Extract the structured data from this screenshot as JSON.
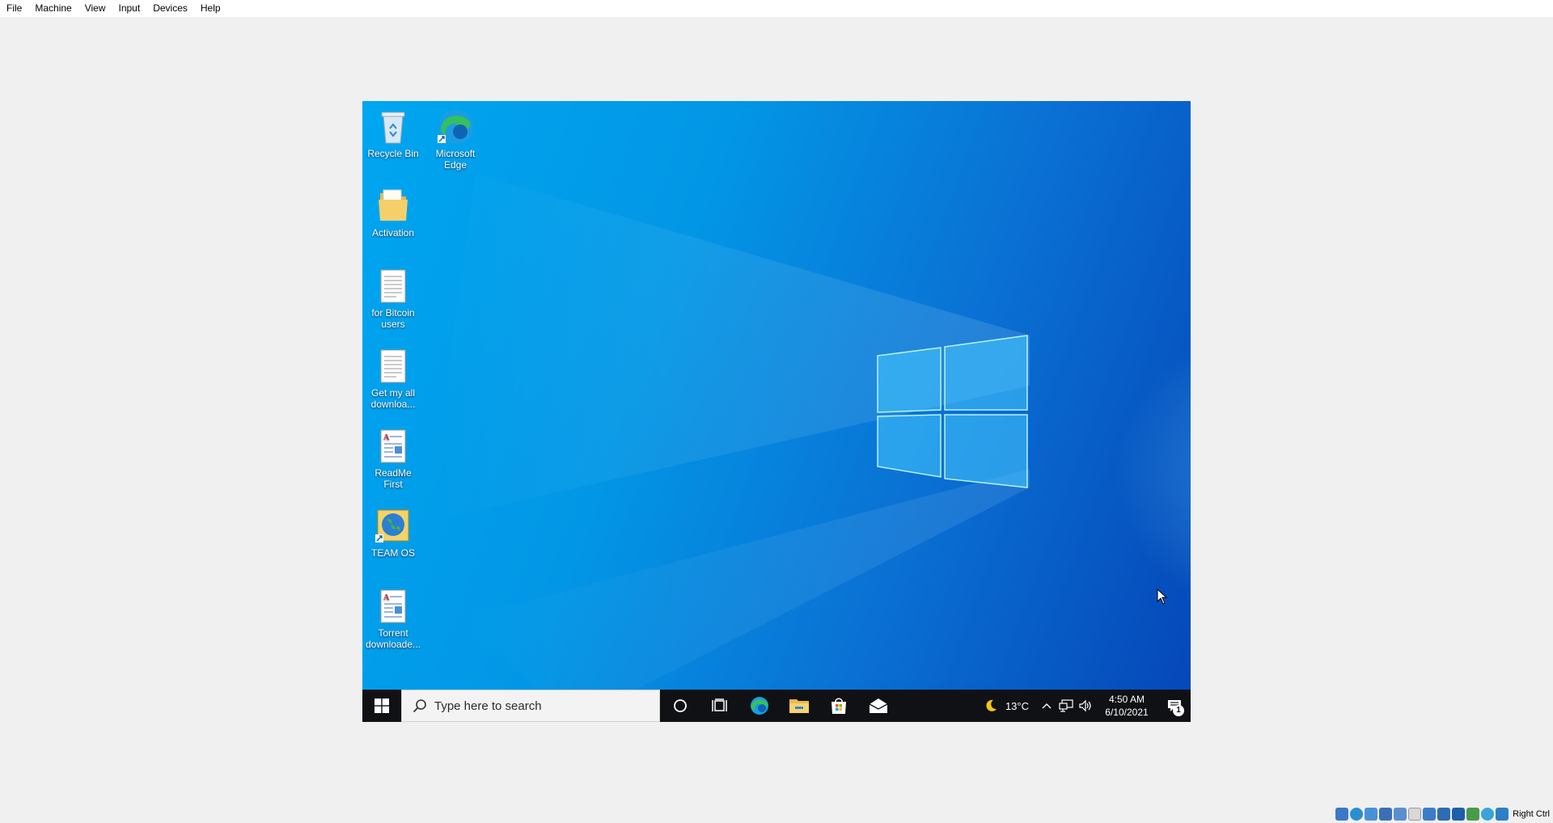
{
  "host": {
    "menu": [
      "File",
      "Machine",
      "View",
      "Input",
      "Devices",
      "Help"
    ],
    "host_key_label": "Right Ctrl",
    "status_icons": [
      "hard-disk-icon",
      "optical-drive-icon",
      "audio-icon",
      "network-icon",
      "usb-icon",
      "shared-folders-icon",
      "display-icon",
      "video-capture-icon",
      "recording-icon",
      "cpu-icon",
      "guest-additions-icon",
      "mouse-integration-icon"
    ]
  },
  "desktop": {
    "icons": [
      {
        "label": "Recycle Bin",
        "icon": "recycle-bin-icon"
      },
      {
        "label": "Microsoft Edge",
        "icon": "edge-icon"
      },
      {
        "label": "Activation",
        "icon": "folder-icon"
      },
      {
        "label": "for Bitcoin users",
        "icon": "text-file-icon"
      },
      {
        "label": "Get my all downloa...",
        "icon": "text-file-icon"
      },
      {
        "label": "ReadMe First",
        "icon": "rich-text-file-icon"
      },
      {
        "label": "TEAM OS",
        "icon": "globe-shortcut-icon"
      },
      {
        "label": "Torrent downloade...",
        "icon": "rich-text-file-icon"
      }
    ]
  },
  "taskbar": {
    "search_placeholder": "Type here to search",
    "pinned": [
      "cortana-icon",
      "task-view-icon",
      "edge-icon",
      "file-explorer-icon",
      "store-icon",
      "mail-icon"
    ],
    "weather_temp": "13°C",
    "weather_icon": "moon-icon",
    "time": "4:50 AM",
    "date": "6/10/2021",
    "notification_count": "1"
  },
  "colors": {
    "taskbar": "#101114",
    "desktop_start": "#00a6f0",
    "desktop_end": "#0546b8"
  }
}
